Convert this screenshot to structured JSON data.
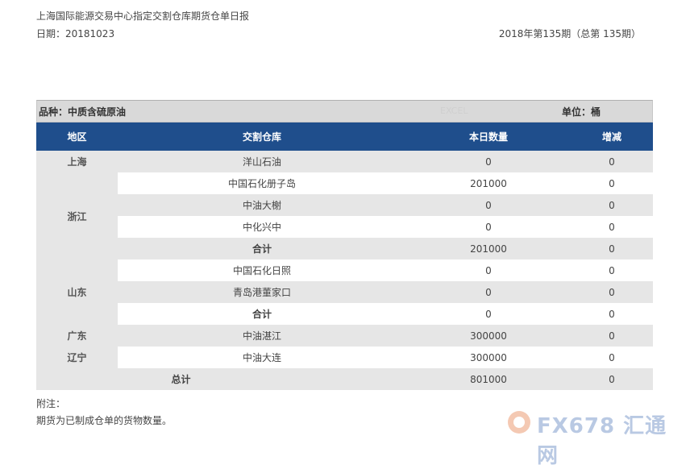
{
  "header": {
    "title": "上海国际能源交易中心指定交割仓库期货仓单日报",
    "date_label": "日期：20181023",
    "period": "2018年第135期（总第 135期）"
  },
  "variety_bar": {
    "variety": "品种：中质含硫原油",
    "excel": "EXCEL",
    "unit": "单位：桶"
  },
  "table": {
    "columns": [
      "地区",
      "交割仓库",
      "本日数量",
      "增减"
    ],
    "rows": [
      {
        "region": "上海",
        "warehouse": "洋山石油",
        "qty": "0",
        "change": "0"
      },
      {
        "region": "浙江",
        "warehouse": "中国石化册子岛",
        "qty": "201000",
        "change": "0"
      },
      {
        "region": "",
        "warehouse": "中油大榭",
        "qty": "0",
        "change": "0"
      },
      {
        "region": "",
        "warehouse": "中化兴中",
        "qty": "0",
        "change": "0"
      },
      {
        "region": "",
        "warehouse": "合计",
        "qty": "201000",
        "change": "0"
      },
      {
        "region": "山东",
        "warehouse": "中国石化日照",
        "qty": "0",
        "change": "0"
      },
      {
        "region": "",
        "warehouse": "青岛港董家口",
        "qty": "0",
        "change": "0"
      },
      {
        "region": "",
        "warehouse": "合计",
        "qty": "0",
        "change": "0"
      },
      {
        "region": "广东",
        "warehouse": "中油湛江",
        "qty": "300000",
        "change": "0"
      },
      {
        "region": "辽宁",
        "warehouse": "中油大连",
        "qty": "300000",
        "change": "0"
      }
    ],
    "grand_total": {
      "label": "总计",
      "qty": "801000",
      "change": "0"
    }
  },
  "notes": {
    "label": "附注：",
    "text": "期货为已制成仓单的货物数量。"
  },
  "watermark": {
    "text": "FX678 汇通网"
  }
}
